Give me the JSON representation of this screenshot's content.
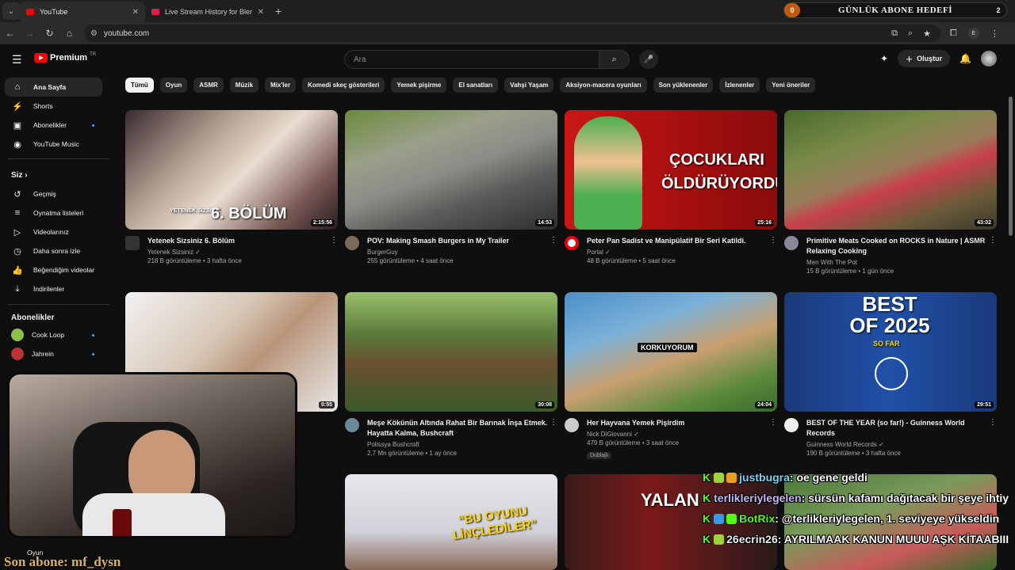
{
  "browser": {
    "tabs": [
      {
        "title": "YouTube",
        "color": "#ff0000"
      },
      {
        "title": "Live Stream History for Blerp Sh",
        "color": "#e11d48"
      }
    ],
    "url": "youtube.com",
    "profile": "E"
  },
  "goal": {
    "current": "0",
    "label": "GÜNLÜK ABONE HEDEFİ",
    "target": "2"
  },
  "youtube": {
    "logo": "Premium",
    "country": "TR",
    "search_placeholder": "Ara",
    "create_label": "Oluştur",
    "sidebar": {
      "main": [
        {
          "label": "Ana Sayfa",
          "icon": "home-icon"
        },
        {
          "label": "Shorts",
          "icon": "shorts-icon"
        },
        {
          "label": "Abonelikler",
          "icon": "subscriptions-icon"
        },
        {
          "label": "YouTube Music",
          "icon": "music-icon"
        }
      ],
      "you_title": "Siz",
      "you": [
        {
          "label": "Geçmiş",
          "icon": "history-icon"
        },
        {
          "label": "Oynatma listeleri",
          "icon": "playlists-icon"
        },
        {
          "label": "Videolarınız",
          "icon": "your-videos-icon"
        },
        {
          "label": "Daha sonra izle",
          "icon": "watch-later-icon"
        },
        {
          "label": "Beğendiğim videolar",
          "icon": "liked-icon"
        },
        {
          "label": "İndirilenler",
          "icon": "downloads-icon"
        }
      ],
      "subs_title": "Abonelikler",
      "subs": [
        {
          "label": "Cook Loop",
          "color": "#8bc34a"
        },
        {
          "label": "Jahrein",
          "color": "#b33"
        }
      ],
      "bottom": "Oyun"
    },
    "chips": [
      "Tümü",
      "Oyun",
      "ASMR",
      "Müzik",
      "Mix'ler",
      "Komedi skeç gösterileri",
      "Yemek pişirme",
      "El sanatları",
      "Vahşi Yaşam",
      "Aksiyon-macera oyunları",
      "Son yüklenenler",
      "İzlenenler",
      "Yeni öneriler"
    ],
    "videos": [
      {
        "title": "Yetenek Sizsiniz 6. Bölüm",
        "channel": "Yetenek Sizsiniz ✓",
        "stats": "218 B görüntüleme • 3 hafta önce",
        "duration": "2:15:56",
        "overlay": "6. BÖLÜM",
        "overlay2": "YETENEK SİZSİNİZ"
      },
      {
        "title": "POV: Making Smash Burgers in My Trailer",
        "channel": "BurgerGuy",
        "stats": "255 görüntüleme • 4 saat önce",
        "duration": "14:53"
      },
      {
        "title": "Peter Pan Sadist ve Manipülatif Bir Seri Katildi.",
        "channel": "Portal ✓",
        "stats": "48 B görüntüleme • 5 saat önce",
        "duration": "25:16",
        "overlay": "ÇOCUKLARI ÖLDÜRÜYORDU."
      },
      {
        "title": "Primitive Meats Cooked on ROCKS in Nature | ASMR Relaxing Cooking",
        "channel": "Men With The Pot",
        "stats": "15 B görüntüleme • 1 gün önce",
        "duration": "43:02"
      },
      {
        "title": "",
        "channel": "",
        "stats": "",
        "duration": "0:55"
      },
      {
        "title": "Meşe Kökünün Altında Rahat Bir Barınak İnşa Etmek. Hayatta Kalma, Bushcraft",
        "channel": "Polissya Bushcraft",
        "stats": "2,7 Mn görüntüleme • 1 ay önce",
        "duration": "30:08"
      },
      {
        "title": "Her Hayvana Yemek Pişirdim",
        "channel": "Nick DiGiovanni ✓",
        "stats": "479 B görüntüleme • 3 saat önce",
        "duration": "24:04",
        "badge": "Dublajlı",
        "overlay": "KORKUYORUM"
      },
      {
        "title": "BEST OF THE YEAR (so far!) - Guinness World Records",
        "channel": "Guinness World Records ✓",
        "stats": "190 B görüntüleme • 3 hafta önce",
        "duration": "29:51",
        "overlay": "BEST OF 2025",
        "overlay2": "SO FAR"
      },
      {
        "overlay": "“BU OYUNU LİNÇLEDİLER”"
      },
      {
        "overlay": "YALAN"
      }
    ]
  },
  "chat": [
    {
      "user": "justbugra",
      "msg": ": oe gene geldi"
    },
    {
      "user": "terlikleriylegelen",
      "msg": ": sürsün kafamı dağıtacak bir şeye ihtiy"
    },
    {
      "user": "BotRix",
      "msg": ": @terlikleriylegelen, 1. seviyeye yükseldin"
    },
    {
      "user": "26ecrin26",
      "msg": ": AYRILMAAK KANUN MUUU AŞK KİTAABIII"
    }
  ],
  "last_sub": "Son abone: mf_dysn"
}
